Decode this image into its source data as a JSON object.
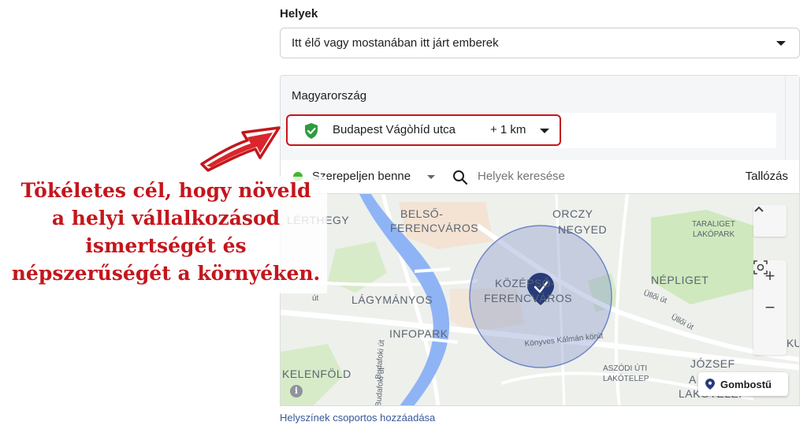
{
  "places": {
    "label": "Helyek",
    "audience_select": "Itt élő vagy mostanában itt járt emberek"
  },
  "location_panel": {
    "country": "Magyarország",
    "location_name": "Budapest Vágòhíd utca",
    "radius": "+ 1 km"
  },
  "toolbar": {
    "include_label": "Szerepeljen benne",
    "search_placeholder": "Helyek keresése",
    "browse_label": "Tallózás"
  },
  "map": {
    "labels": {
      "belso": "BELSŐ-",
      "ferencvaros": "FERENCVÁROS",
      "orczy": "ORCZY",
      "negyed": "NEGYED",
      "taraliget": "TARALIGET",
      "lakopark": "LAKÓPARK",
      "nepliget": "NÉPLIGET",
      "gellerthegy": "LÉRTHEGY",
      "lagymanyos": "LÁGYMÁNYOS",
      "kozep": "KÖZÉPSŐ-",
      "kozep_ferencvaros": "FERENCVÁROS",
      "infopark": "INFOPARK",
      "kelenfold": "KELENFÖLD",
      "aszodi": "ASZÓDI ÚTI",
      "lakotelep": "LAKÓTELEP",
      "jozsef": "JÓZSEF",
      "a": "A",
      "lakotelep2": "LAKÓTELEP",
      "konyves": "Könyves Kálmán körút",
      "ulloi1": "Üllői út",
      "ulloi2": "Üllői út",
      "budafoki1": "Budafoki út",
      "budafoki2": "Budafoki út",
      "ut": "út",
      "ku": "KU"
    },
    "zoom_in": "+",
    "zoom_out": "−",
    "pin_button": "Gombostű",
    "info": "i"
  },
  "footer": {
    "add_group_link": "Helyszínek csoportos hozzáadása"
  },
  "callout": {
    "lines": [
      "Tökéletes cél, hogy növeld",
      "a helyi vállalkozásod",
      "ismertségét és",
      "népszerűségét a környéken."
    ]
  },
  "colors": {
    "accent_red": "#c4161c",
    "include_green": "#42b72a",
    "link_blue": "#385898",
    "river_blue": "#8fb4f5",
    "park_green": "#c8e6b4",
    "radius_circle": "rgba(120,140,200,0.35)"
  }
}
